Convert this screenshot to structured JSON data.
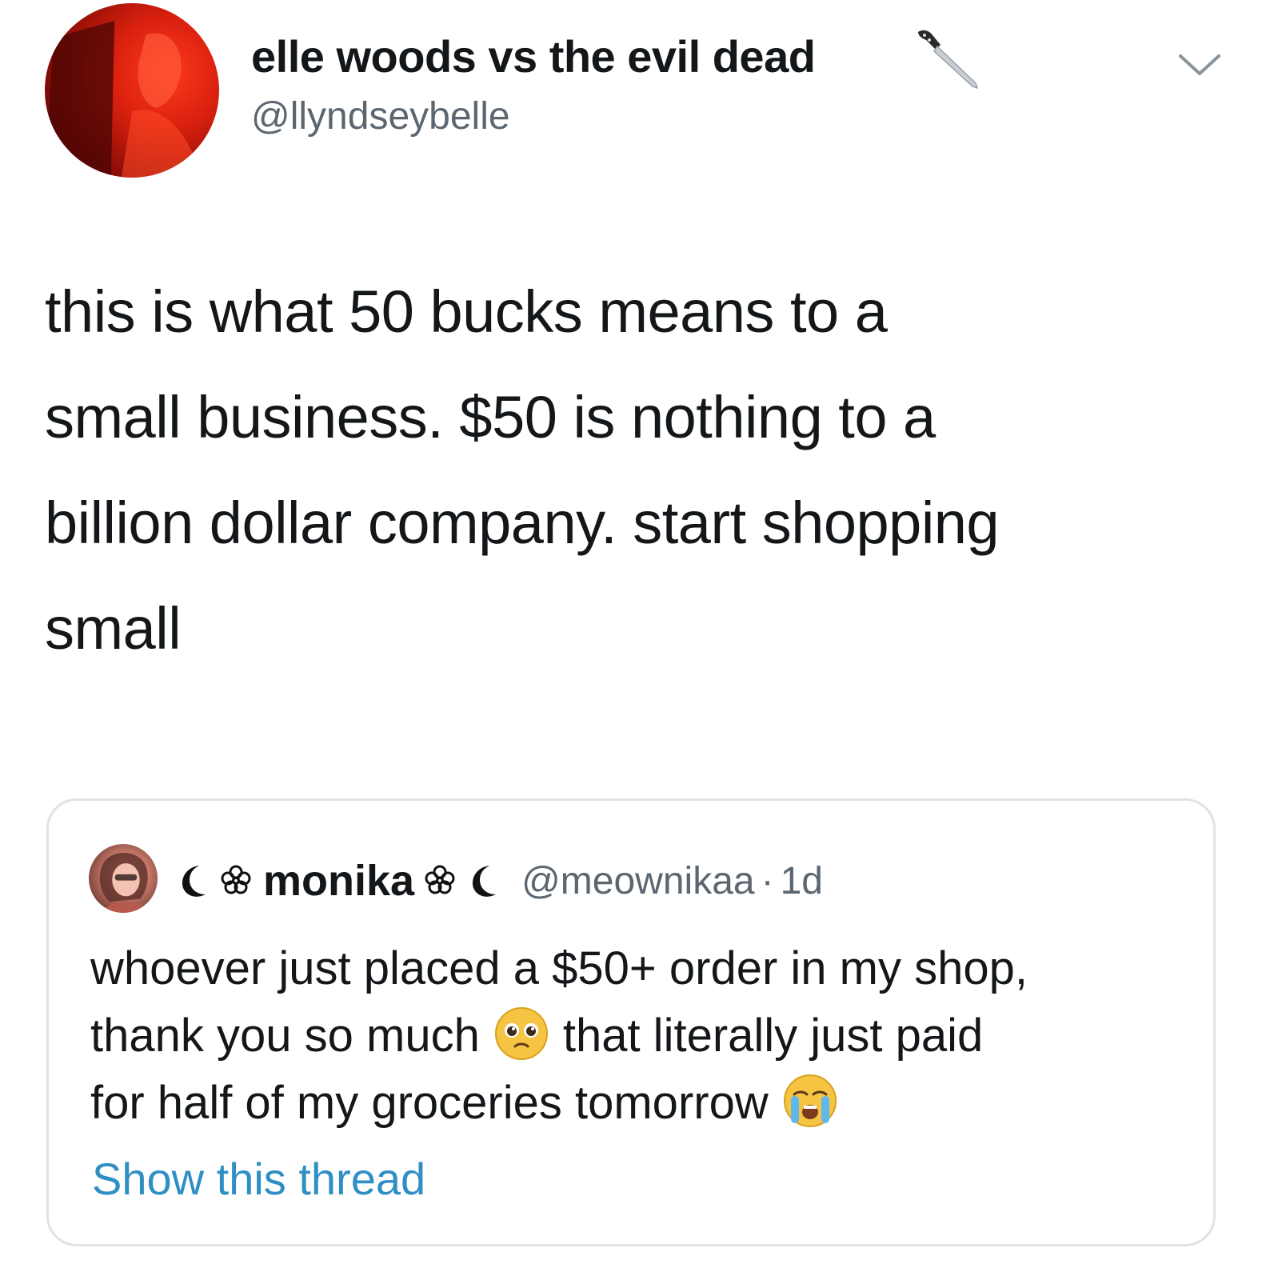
{
  "tweet": {
    "display_name": "elle woods vs the evil dead",
    "handle": "@llyndseybelle",
    "text_lines": [
      "this is what 50 bucks means to a",
      "small business. $50 is nothing to a",
      "billion dollar company. start shopping",
      "small"
    ],
    "icons": {
      "name_emoji": "knife-icon",
      "menu": "chevron-down-icon"
    }
  },
  "quoted_tweet": {
    "display_name": "monika",
    "name_decorations": [
      "crescent-moon-icon",
      "flower-icon"
    ],
    "handle": "@meownikaa",
    "separator": "·",
    "time": "1d",
    "text_line_1": "whoever just placed a $50+ order in my shop,",
    "text_line_2a": "thank you so much",
    "text_line_2b": "that literally just paid",
    "text_line_3": "for half of my groceries tomorrow",
    "emojis": [
      "pleading-face-icon",
      "loudly-crying-face-icon"
    ],
    "show_thread_label": "Show this thread"
  },
  "colors": {
    "text": "#14171a",
    "secondary": "#5b6670",
    "link": "#2f8fc4",
    "border": "#dfe3e7"
  }
}
